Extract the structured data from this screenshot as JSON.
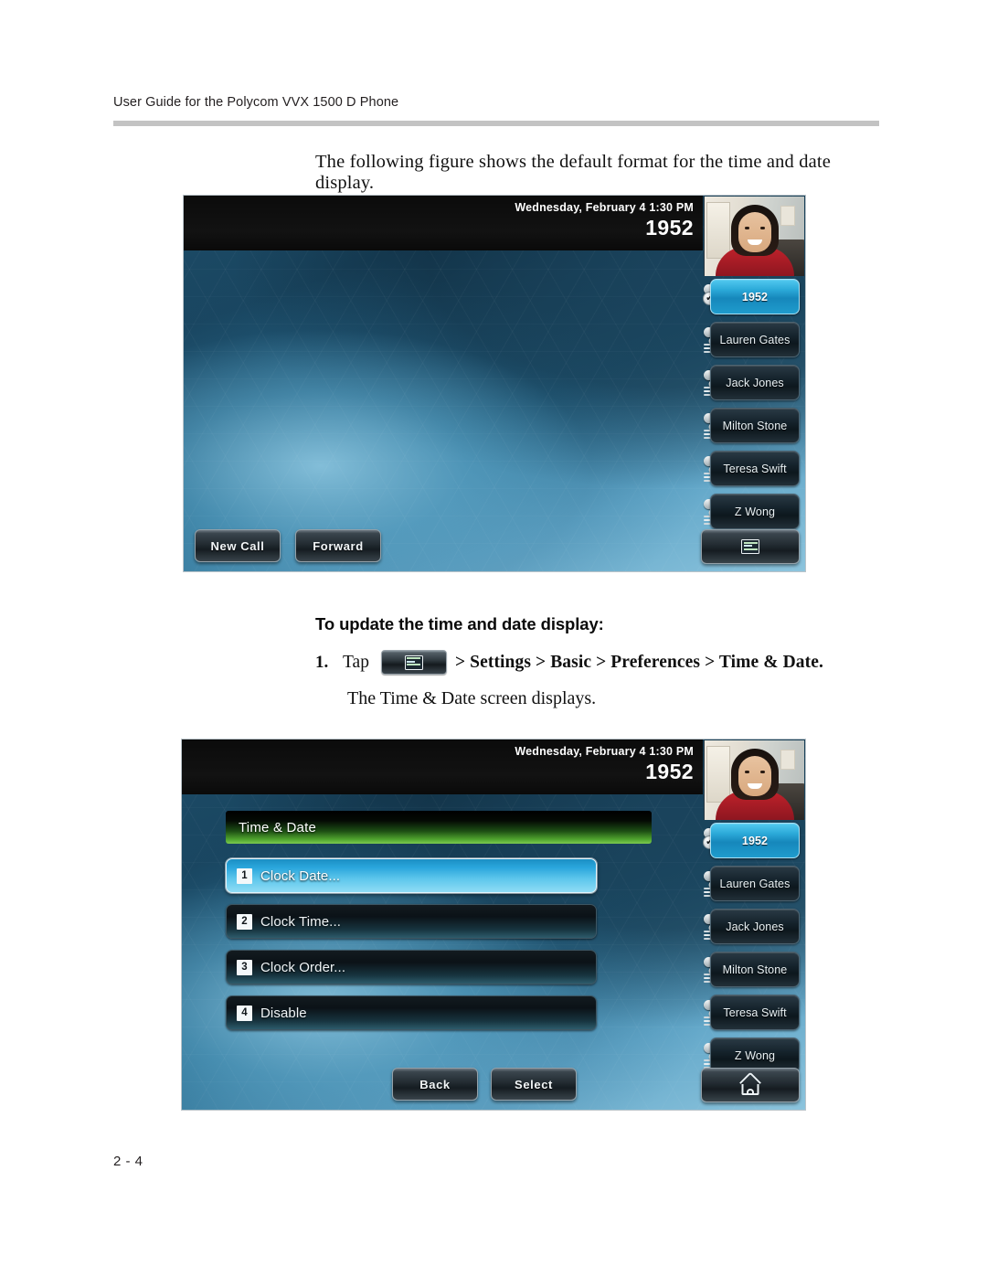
{
  "document": {
    "header_title": "User Guide for the Polycom VVX 1500 D Phone",
    "page_number": "2 - 4"
  },
  "body": {
    "intro_line": "The following figure shows the default format for the time and date display.",
    "section_heading": "To update the time and date display:",
    "step_number": "1.",
    "step_tap_label": "Tap",
    "step_menu_icon": "menu-window-icon",
    "step_path": "> Settings > Basic > Preferences > Time & Date.",
    "step_result": "The Time & Date screen displays."
  },
  "phone_home": {
    "status": {
      "datetime": "Wednesday, February 4  1:30 PM",
      "extension": "1952"
    },
    "video_tile": "self-view-video",
    "line_keys": [
      {
        "label": "1952",
        "active": true,
        "icon": "handset-registered-icon"
      },
      {
        "label": "Lauren Gates",
        "active": false,
        "icon": "handset-icon"
      },
      {
        "label": "Jack Jones",
        "active": false,
        "icon": "handset-icon"
      },
      {
        "label": "Milton Stone",
        "active": false,
        "icon": "handset-icon"
      },
      {
        "label": "Teresa Swift",
        "active": false,
        "icon": "handset-icon"
      },
      {
        "label": "Z Wong",
        "active": false,
        "icon": "handset-icon"
      }
    ],
    "soft_keys": [
      {
        "label": "New Call"
      },
      {
        "label": "Forward"
      }
    ],
    "corner_key_icon": "menu-window-icon"
  },
  "phone_menu": {
    "status": {
      "datetime": "Wednesday, February 4  1:30 PM",
      "extension": "1952"
    },
    "menu_title": "Time & Date",
    "menu_items": [
      {
        "index": "1",
        "label": "Clock Date...",
        "selected": true
      },
      {
        "index": "2",
        "label": "Clock Time...",
        "selected": false
      },
      {
        "index": "3",
        "label": "Clock Order...",
        "selected": false
      },
      {
        "index": "4",
        "label": "Disable",
        "selected": false
      }
    ],
    "line_keys": [
      {
        "label": "1952",
        "active": true,
        "icon": "handset-registered-icon"
      },
      {
        "label": "Lauren Gates",
        "active": false,
        "icon": "handset-icon"
      },
      {
        "label": "Jack Jones",
        "active": false,
        "icon": "handset-icon"
      },
      {
        "label": "Milton Stone",
        "active": false,
        "icon": "handset-icon"
      },
      {
        "label": "Teresa Swift",
        "active": false,
        "icon": "handset-icon"
      },
      {
        "label": "Z Wong",
        "active": false,
        "icon": "handset-icon"
      }
    ],
    "soft_keys": [
      {
        "label": "Back"
      },
      {
        "label": "Select"
      }
    ],
    "corner_key_icon": "home-icon"
  },
  "colors": {
    "accent_blue": "#2ba9d8",
    "title_green": "#52a830",
    "rule_gray": "#c3c3c3"
  }
}
